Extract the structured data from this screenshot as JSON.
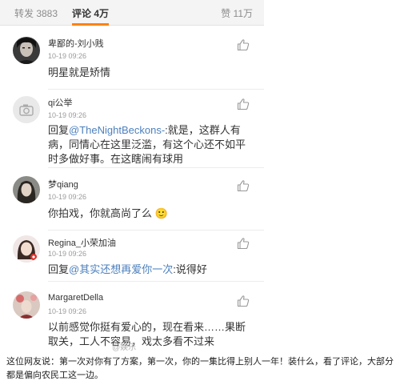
{
  "tabs": {
    "repost": "转发 3883",
    "comments": "评论 4万",
    "likes": "赞 11万"
  },
  "comments": [
    {
      "username": "卑鄙的-刘小贱",
      "time": "10-19 09:26",
      "text": "明星就是矫情",
      "avatar": "dark-portrait-avatar"
    },
    {
      "username": "qi公举",
      "time": "10-19 09:26",
      "reply_prefix": "回复",
      "mention": "@TheNightBeckons-",
      "text": ":就是，这群人有病，同情心在这里泛滥，有这个心还不如平时多做好事。在这瞎闹有球用",
      "avatar": "default-camera-avatar"
    },
    {
      "username": "梦qiang",
      "time": "10-19 09:26",
      "text": "你拍戏，你就高尚了么",
      "emoji": "🙂",
      "avatar": "long-hair-portrait-avatar"
    },
    {
      "username": "Regina_小荣加油",
      "time": "10-19 09:26",
      "reply_prefix": "回复",
      "mention": "@其实还想再爱你一次",
      "text": ":说得好",
      "avatar": "girl-portrait-avatar"
    },
    {
      "username": "MargaretDella",
      "time": "10-19 09:26",
      "text": "以前感觉你挺有爱心的，现在看来……果断取关，工人不容易，戏太多看不过来",
      "avatar": "floral-portrait-avatar"
    }
  ],
  "watermark": "@娱乐",
  "caption": "这位网友说：第一次对你有了方案，第一次，你的一集比得上别人一年！装什么，看了评论，大部分都是偏向农民工这一边。",
  "colors": {
    "accent": "#ff8200",
    "mention": "#4d80bd",
    "timestamp": "#9a9a9a"
  }
}
